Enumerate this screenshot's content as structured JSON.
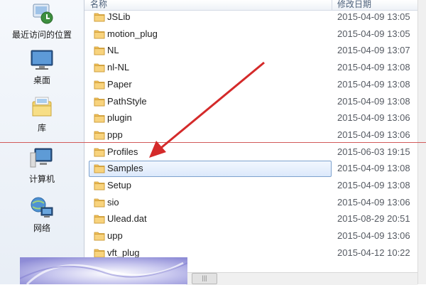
{
  "nav": {
    "items": [
      {
        "label": "最近访问的位置",
        "icon": "recent-places-icon"
      },
      {
        "label": "桌面",
        "icon": "desktop-icon"
      },
      {
        "label": "库",
        "icon": "libraries-icon"
      },
      {
        "label": "计算机",
        "icon": "computer-icon"
      },
      {
        "label": "网络",
        "icon": "network-icon"
      }
    ]
  },
  "list": {
    "headers": {
      "name": "名称",
      "date": "修改日期"
    },
    "rows": [
      {
        "name": "JSLib",
        "date": "2015-04-09 13:05",
        "type": "folder"
      },
      {
        "name": "motion_plug",
        "date": "2015-04-09 13:05",
        "type": "folder"
      },
      {
        "name": "NL",
        "date": "2015-04-09 13:07",
        "type": "folder"
      },
      {
        "name": "nl-NL",
        "date": "2015-04-09 13:08",
        "type": "folder"
      },
      {
        "name": "Paper",
        "date": "2015-04-09 13:08",
        "type": "folder"
      },
      {
        "name": "PathStyle",
        "date": "2015-04-09 13:08",
        "type": "folder"
      },
      {
        "name": "plugin",
        "date": "2015-04-09 13:06",
        "type": "folder"
      },
      {
        "name": "ppp",
        "date": "2015-04-09 13:06",
        "type": "folder"
      },
      {
        "name": "Profiles",
        "date": "2015-06-03 19:15",
        "type": "folder"
      },
      {
        "name": "Samples",
        "date": "2015-04-09 13:08",
        "type": "folder",
        "selected": true
      },
      {
        "name": "Setup",
        "date": "2015-04-09 13:08",
        "type": "folder"
      },
      {
        "name": "sio",
        "date": "2015-04-09 13:06",
        "type": "folder"
      },
      {
        "name": "Ulead.dat",
        "date": "2015-08-29 20:51",
        "type": "folder"
      },
      {
        "name": "upp",
        "date": "2015-04-09 13:06",
        "type": "folder"
      },
      {
        "name": "vft_plug",
        "date": "2015-04-12 10:22",
        "type": "folder"
      }
    ]
  },
  "scroll": {
    "hthumb_glyph": "|||"
  },
  "colors": {
    "selection": "#dce9fb",
    "annotation": "#d42a2a",
    "folder": "#f2c15b"
  }
}
